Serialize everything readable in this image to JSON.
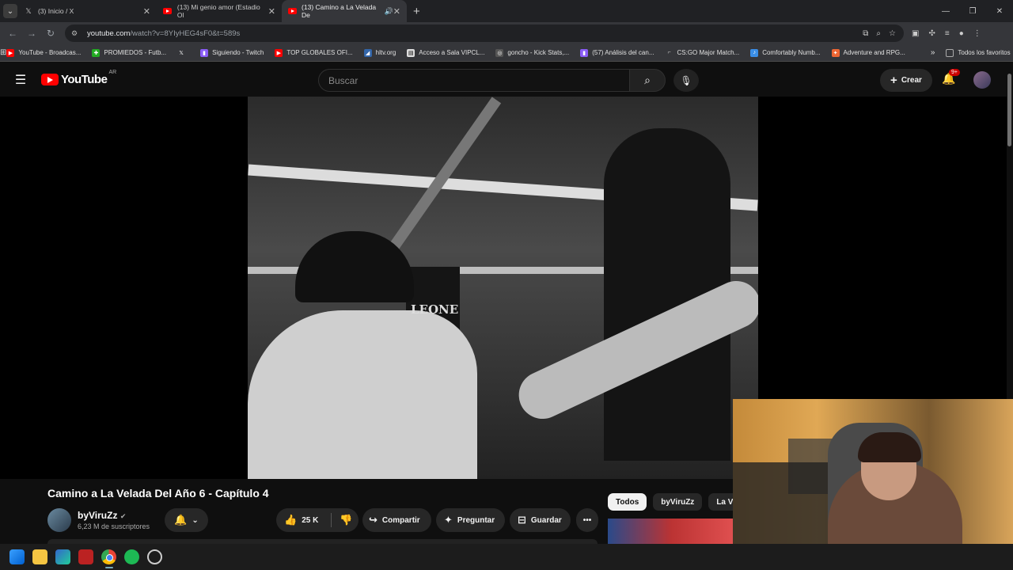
{
  "browser": {
    "tabs": [
      {
        "title": "(3) Inicio / X",
        "icon": "x-logo-icon"
      },
      {
        "title": "(13) Mi genio amor (Estadio Ol",
        "icon": "youtube-icon"
      },
      {
        "title": "(13) Camino a La Velada De",
        "icon": "youtube-icon",
        "active": true
      }
    ],
    "url_host": "youtube.com",
    "url_path": "/watch?v=8YIyHEG4sF0&t=589s",
    "bookmarks": [
      "YouTube - Broadcas...",
      "PROMIEDOS - Futb...",
      "",
      "Siguiendo - Twitch",
      "TOP GLOBALES OFI...",
      "hltv.org",
      "Acceso a Sala VIPCL...",
      "goncho - Kick Stats,...",
      "(57) Análisis del can...",
      "CS:GO Major Match...",
      "Comfortably Numb...",
      "Adventure and RPG..."
    ],
    "all_bookmarks": "Todos los favoritos"
  },
  "youtube": {
    "logo_text": "YouTube",
    "region": "AR",
    "search_placeholder": "Buscar",
    "create_label": "Crear",
    "notif_badge": "9+"
  },
  "video": {
    "ring_brand": "LEONE",
    "title": "Camino a La Velada Del Año 6 - Capítulo 4",
    "channel_name": "byViruZz",
    "subscribers": "6,23 M de suscriptores",
    "likes": "25 K",
    "share_label": "Compartir",
    "ask_label": "Preguntar",
    "save_label": "Guardar"
  },
  "chips": [
    "Todos",
    "byViruZz",
    "La Vela"
  ],
  "colors": {
    "accent": "#ff0000",
    "bg": "#0f0f0f",
    "pill": "#272727"
  }
}
